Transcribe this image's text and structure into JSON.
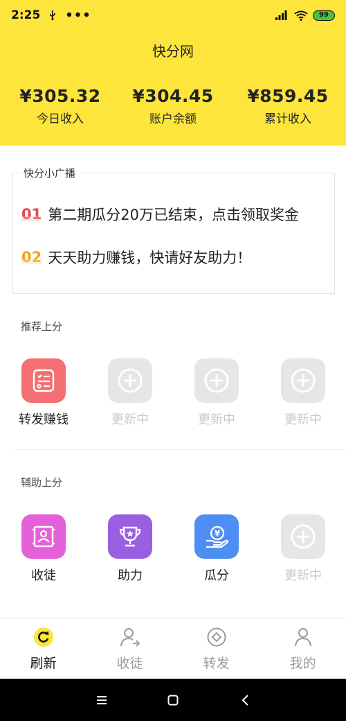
{
  "status_bar": {
    "time": "2:25",
    "dots": "•••",
    "battery": "99",
    "battery_color": "#48c13b"
  },
  "header": {
    "title": "快分网",
    "background": "#fde53c",
    "stats": [
      {
        "value": "¥305.32",
        "label": "今日收入"
      },
      {
        "value": "¥304.45",
        "label": "账户余额"
      },
      {
        "value": "¥859.45",
        "label": "累计收入"
      }
    ]
  },
  "broadcast": {
    "title": "快分小广播",
    "items": [
      {
        "num": "01",
        "text": "第二期瓜分20万已结束，点击领取奖金"
      },
      {
        "num": "02",
        "text": "天天助力赚钱，快请好友助力！"
      }
    ]
  },
  "recommended": {
    "label": "推荐上分",
    "tiles": [
      {
        "label": "转发赚钱",
        "icon": "checklist-icon",
        "color": "#f46f72"
      },
      {
        "label": "更新中",
        "icon": "plus-circle-icon",
        "color": "#e6e6e6"
      },
      {
        "label": "更新中",
        "icon": "plus-circle-icon",
        "color": "#e6e6e6"
      },
      {
        "label": "更新中",
        "icon": "plus-circle-icon",
        "color": "#e6e6e6"
      }
    ]
  },
  "assist": {
    "label": "辅助上分",
    "tiles": [
      {
        "label": "收徒",
        "icon": "scroll-person-icon",
        "color": "#e461d9"
      },
      {
        "label": "助力",
        "icon": "trophy-icon",
        "color": "#9a5fe1"
      },
      {
        "label": "瓜分",
        "icon": "coin-hand-icon",
        "color": "#4e8ef2"
      },
      {
        "label": "更新中",
        "icon": "plus-circle-icon",
        "color": "#e6e6e6"
      }
    ]
  },
  "tabbar": {
    "tabs": [
      {
        "label": "刷新",
        "icon": "refresh-icon",
        "active": true
      },
      {
        "label": "收徒",
        "icon": "user-arrow-icon",
        "active": false
      },
      {
        "label": "转发",
        "icon": "share-diamond-icon",
        "active": false
      },
      {
        "label": "我的",
        "icon": "user-icon",
        "active": false
      }
    ]
  },
  "system_nav": {
    "buttons": [
      "menu-icon",
      "home-square-icon",
      "back-chevron-icon"
    ]
  }
}
